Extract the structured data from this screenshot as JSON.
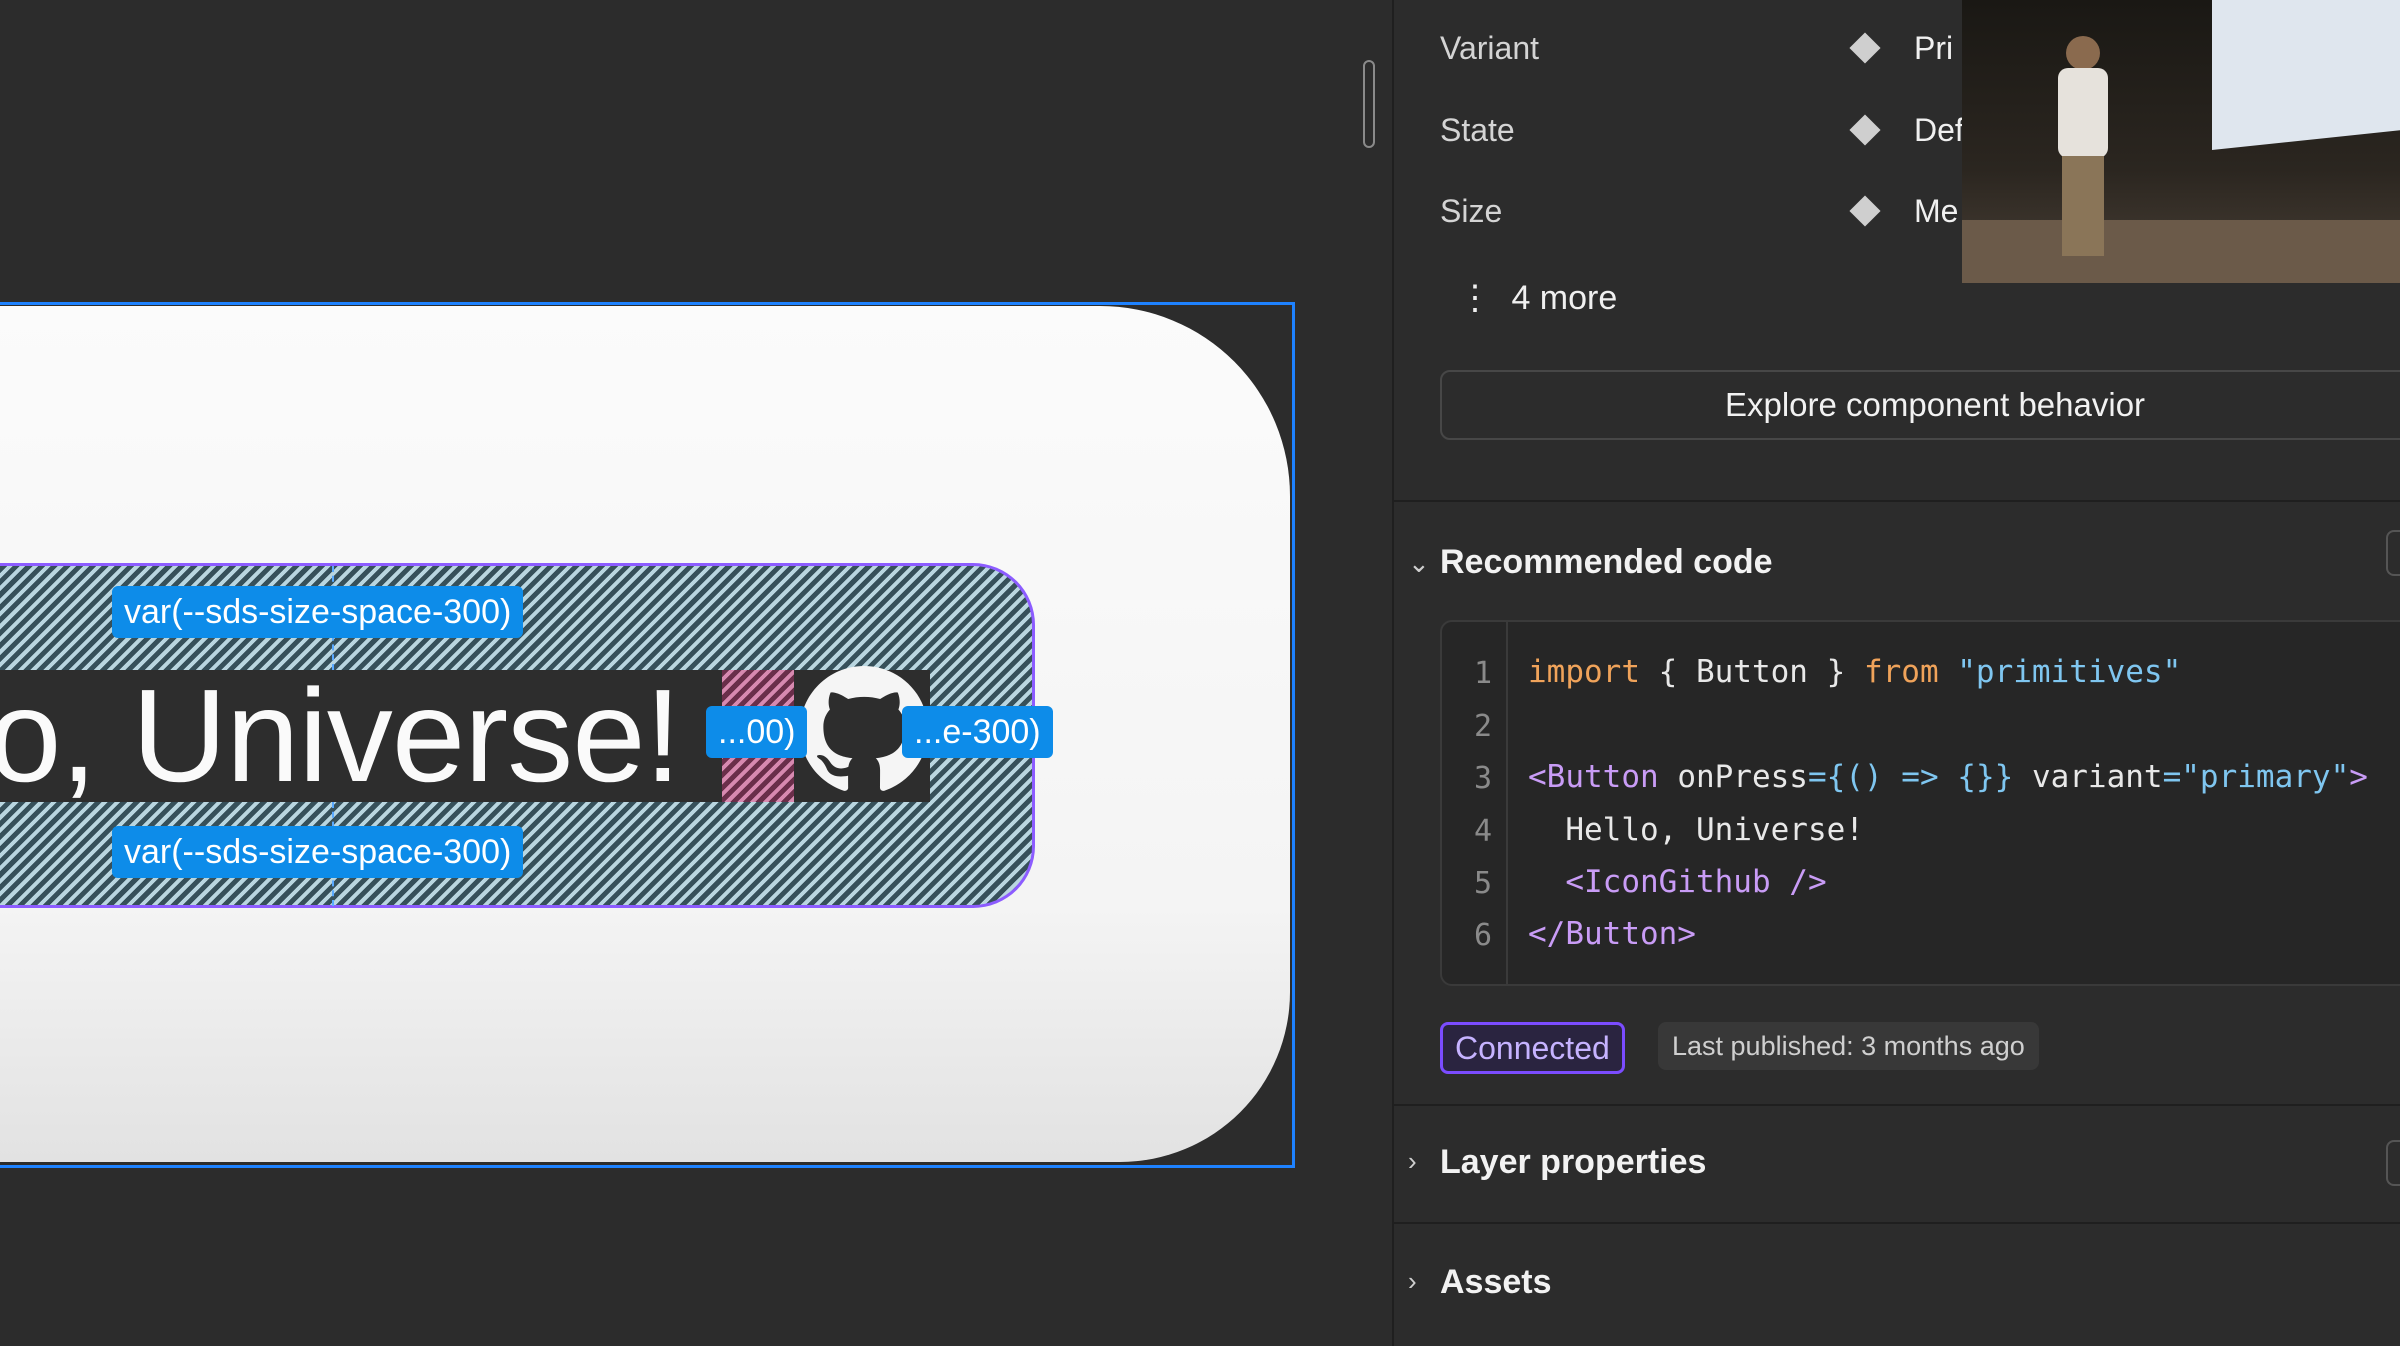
{
  "canvas": {
    "padding_token_top": "var(--sds-size-space-300)",
    "padding_token_bottom": "var(--sds-size-space-300)",
    "gap_token_truncated": "...00)",
    "padding_token_right_truncated": "...e-300)",
    "button_text": "o, Universe!"
  },
  "properties": [
    {
      "label": "Variant",
      "value": "Pri"
    },
    {
      "label": "State",
      "value": "Def"
    },
    {
      "label": "Size",
      "value": "Me"
    }
  ],
  "more_label": "4 more",
  "explore_button": "Explore component behavior",
  "recommended_code": {
    "title": "Recommended code",
    "line_numbers": [
      "1",
      "2",
      "3",
      "4",
      "5",
      "6"
    ]
  },
  "status": {
    "connected": "Connected",
    "published": "Last published: 3 months ago"
  },
  "sections": {
    "layer_properties": "Layer properties",
    "assets": "Assets"
  },
  "colors": {
    "selection_blue": "#1e82ff",
    "token_chip": "#0d8ce9",
    "connected_purple": "#7b4cff"
  },
  "icons": [
    "github-icon",
    "diamond-icon",
    "kebab-icon",
    "chevron-down-icon",
    "chevron-right-icon"
  ]
}
